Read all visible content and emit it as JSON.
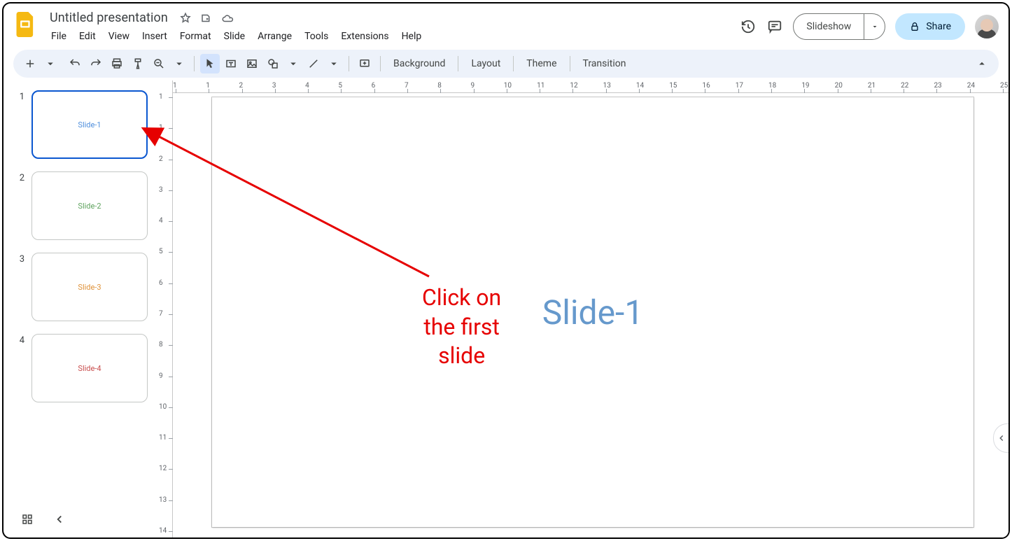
{
  "doc": {
    "title": "Untitled presentation"
  },
  "menus": [
    "File",
    "Edit",
    "View",
    "Insert",
    "Format",
    "Slide",
    "Arrange",
    "Tools",
    "Extensions",
    "Help"
  ],
  "header_buttons": {
    "slideshow": "Slideshow",
    "share": "Share"
  },
  "toolbar_text": {
    "background": "Background",
    "layout": "Layout",
    "theme": "Theme",
    "transition": "Transition"
  },
  "slides": [
    {
      "num": "1",
      "label": "Slide-1",
      "color": "#4f8fdd",
      "selected": true
    },
    {
      "num": "2",
      "label": "Slide-2",
      "color": "#5fa35f",
      "selected": false
    },
    {
      "num": "3",
      "label": "Slide-3",
      "color": "#e0933a",
      "selected": false
    },
    {
      "num": "4",
      "label": "Slide-4",
      "color": "#c94f4f",
      "selected": false
    }
  ],
  "canvas": {
    "text": "Slide-1",
    "color": "#6699cc"
  },
  "hruler_numbers": [
    "1",
    "1",
    "2",
    "3",
    "4",
    "5",
    "6",
    "7",
    "8",
    "9",
    "10",
    "11",
    "12",
    "13",
    "14",
    "15",
    "16",
    "17",
    "18",
    "19",
    "20",
    "21",
    "22",
    "23",
    "24",
    "25"
  ],
  "vruler_numbers": [
    "1",
    "1",
    "2",
    "3",
    "4",
    "5",
    "6",
    "7",
    "8",
    "9",
    "10",
    "11",
    "12",
    "13",
    "14"
  ],
  "annotation": {
    "line1": "Click on",
    "line2": "the first",
    "line3": "slide"
  }
}
